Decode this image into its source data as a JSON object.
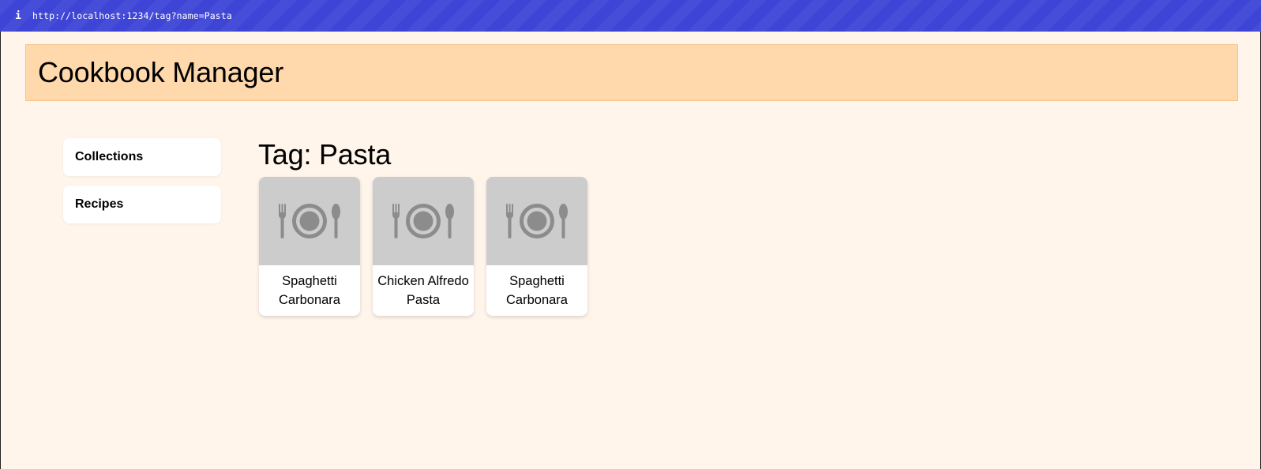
{
  "browser": {
    "url": "http://localhost:1234/tag?name=Pasta",
    "info_icon": "i"
  },
  "header": {
    "title": "Cookbook Manager"
  },
  "sidebar": {
    "items": [
      {
        "label": "Collections"
      },
      {
        "label": "Recipes"
      }
    ]
  },
  "main": {
    "heading": "Tag: Pasta",
    "recipes": [
      {
        "name": "Spaghetti Carbonara",
        "image_icon": "plate-fork-spoon-icon"
      },
      {
        "name": "Chicken Alfredo Pasta",
        "image_icon": "plate-fork-spoon-icon"
      },
      {
        "name": "Spaghetti Carbonara",
        "image_icon": "plate-fork-spoon-icon"
      }
    ]
  },
  "colors": {
    "url_bar": "#3e45d6",
    "header_bg": "#ffd8ab",
    "page_bg": "#fff5eb",
    "placeholder_bg": "#cccccc",
    "placeholder_icon": "#8c8c8c"
  }
}
